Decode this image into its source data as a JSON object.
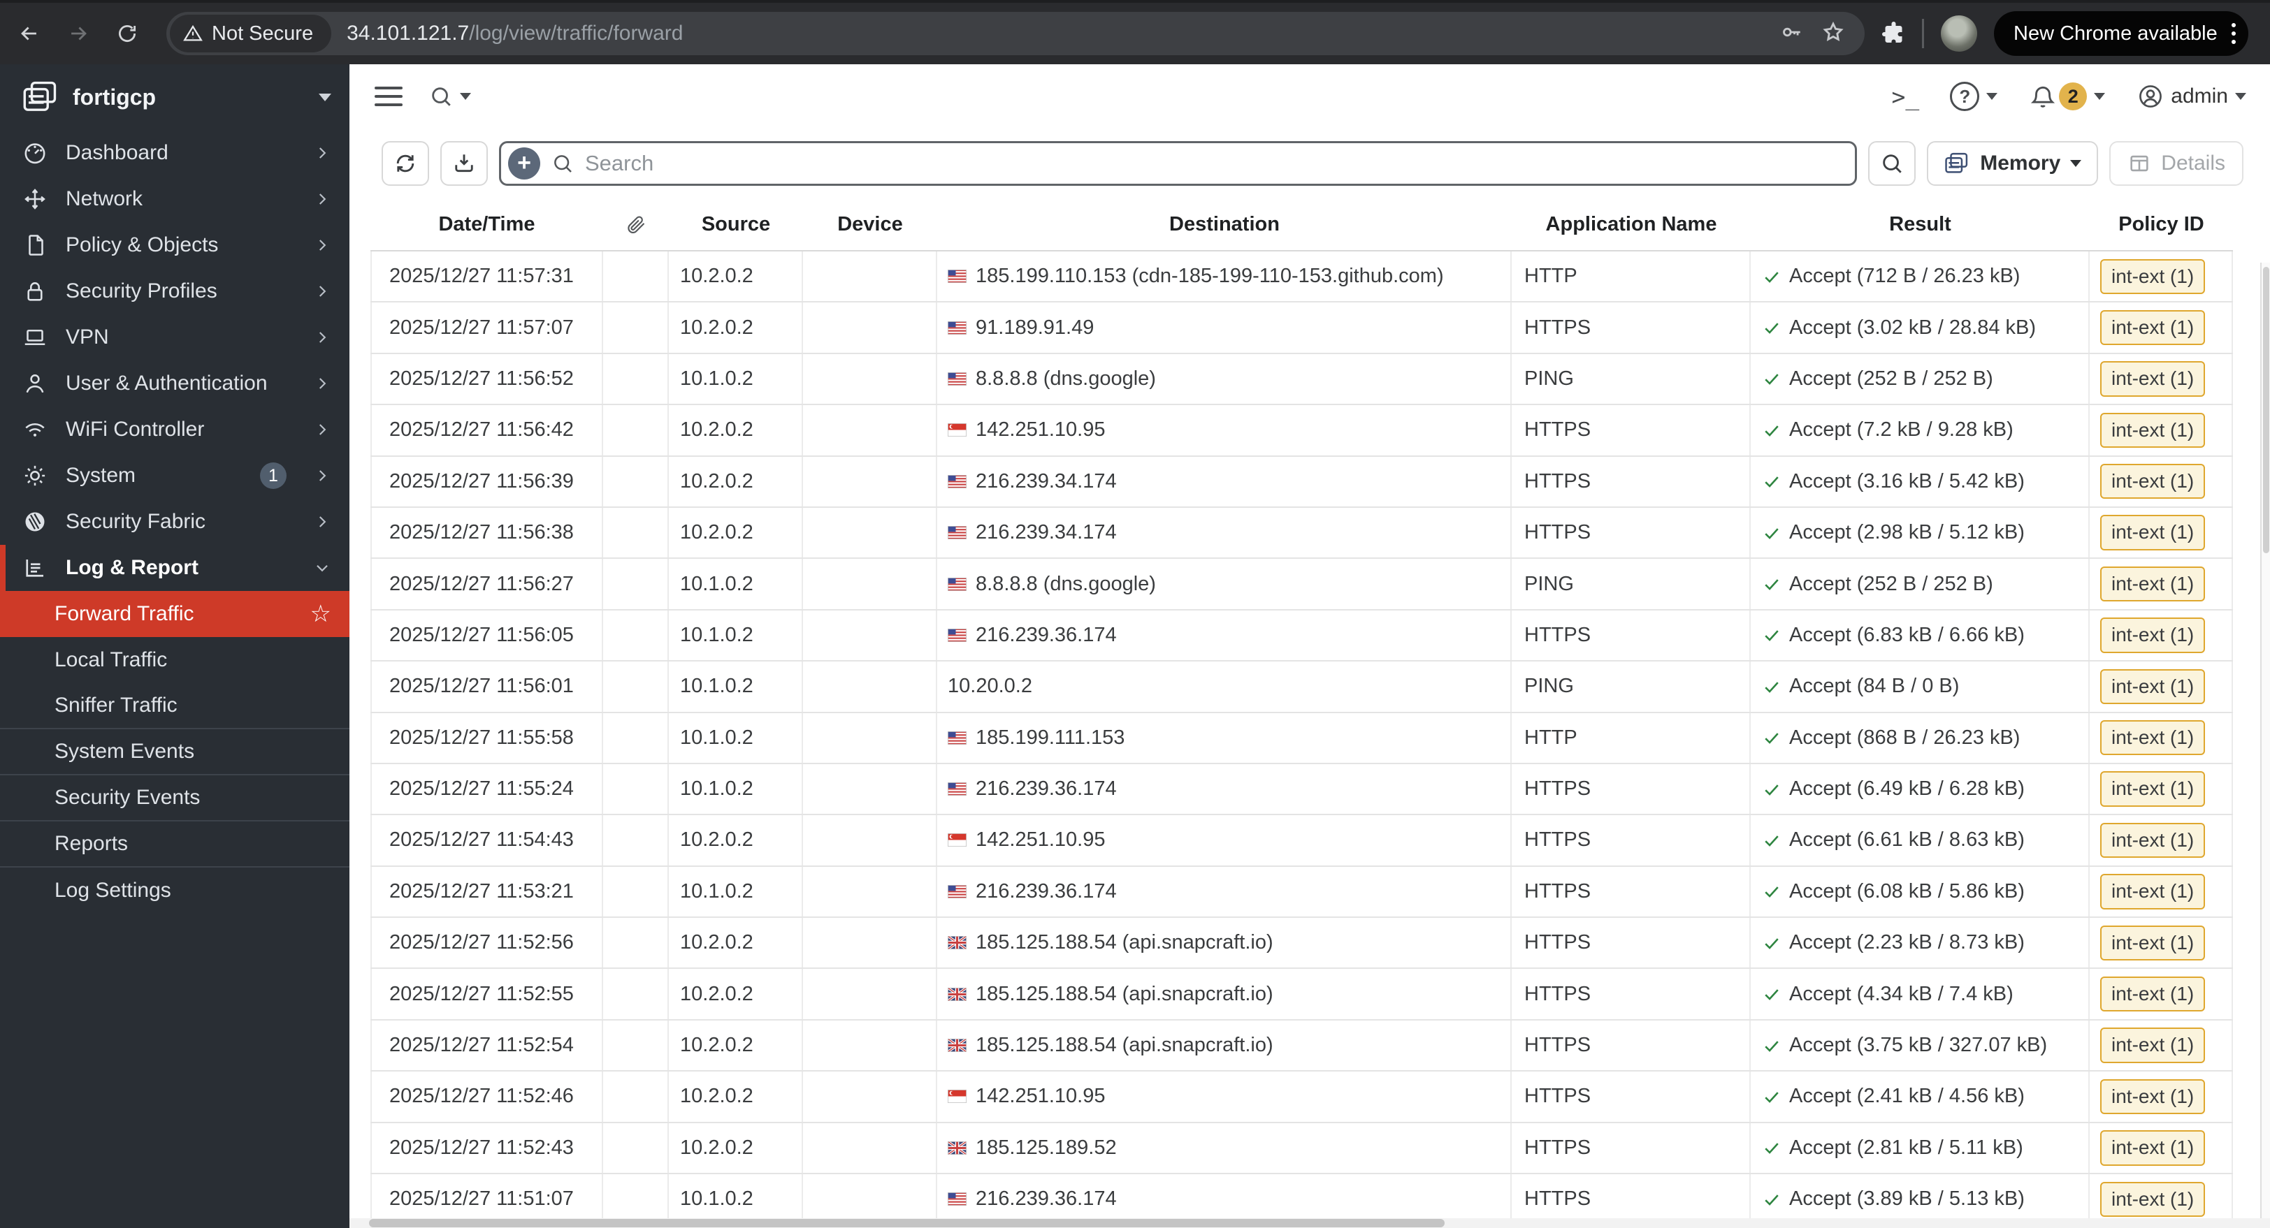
{
  "browser": {
    "security_chip": "Not Secure",
    "url_host": "34.101.121.7",
    "url_path": "/log/view/traffic/forward",
    "update_button": "New Chrome available"
  },
  "sidebar": {
    "brand": "fortigcp",
    "items": [
      {
        "label": "Dashboard",
        "icon": "dashboard"
      },
      {
        "label": "Network",
        "icon": "network"
      },
      {
        "label": "Policy & Objects",
        "icon": "policy"
      },
      {
        "label": "Security Profiles",
        "icon": "lock"
      },
      {
        "label": "VPN",
        "icon": "vpn"
      },
      {
        "label": "User & Authentication",
        "icon": "user"
      },
      {
        "label": "WiFi Controller",
        "icon": "wifi"
      },
      {
        "label": "System",
        "icon": "gear",
        "badge": "1"
      },
      {
        "label": "Security Fabric",
        "icon": "fabric"
      },
      {
        "label": "Log & Report",
        "icon": "log",
        "expanded": true
      }
    ],
    "submenu": [
      {
        "label": "Forward Traffic",
        "active": true,
        "starred": true
      },
      {
        "label": "Local Traffic"
      },
      {
        "label": "Sniffer Traffic",
        "divider_after": true
      },
      {
        "label": "System Events",
        "divider_after": true
      },
      {
        "label": "Security Events",
        "divider_after": true
      },
      {
        "label": "Reports",
        "divider_after": true
      },
      {
        "label": "Log Settings"
      }
    ]
  },
  "header": {
    "notification_count": "2",
    "user": "admin"
  },
  "toolbar": {
    "search_placeholder": "Search",
    "view_mode": "Memory",
    "details_label": "Details"
  },
  "table": {
    "columns": [
      "Date/Time",
      "",
      "Source",
      "Device",
      "Destination",
      "Application Name",
      "Result",
      "Policy ID"
    ],
    "rows": [
      {
        "datetime": "2025/12/27 11:57:31",
        "source": "10.2.0.2",
        "device": "",
        "flag": "us",
        "destination": "185.199.110.153 (cdn-185-199-110-153.github.com)",
        "app": "HTTP",
        "result": "Accept (712 B / 26.23 kB)",
        "policy": "int-ext (1)"
      },
      {
        "datetime": "2025/12/27 11:57:07",
        "source": "10.2.0.2",
        "device": "",
        "flag": "us",
        "destination": "91.189.91.49",
        "app": "HTTPS",
        "result": "Accept (3.02 kB / 28.84 kB)",
        "policy": "int-ext (1)"
      },
      {
        "datetime": "2025/12/27 11:56:52",
        "source": "10.1.0.2",
        "device": "",
        "flag": "us",
        "destination": "8.8.8.8 (dns.google)",
        "app": "PING",
        "result": "Accept (252 B / 252 B)",
        "policy": "int-ext (1)"
      },
      {
        "datetime": "2025/12/27 11:56:42",
        "source": "10.2.0.2",
        "device": "",
        "flag": "sg",
        "destination": "142.251.10.95",
        "app": "HTTPS",
        "result": "Accept (7.2 kB / 9.28 kB)",
        "policy": "int-ext (1)"
      },
      {
        "datetime": "2025/12/27 11:56:39",
        "source": "10.2.0.2",
        "device": "",
        "flag": "us",
        "destination": "216.239.34.174",
        "app": "HTTPS",
        "result": "Accept (3.16 kB / 5.42 kB)",
        "policy": "int-ext (1)"
      },
      {
        "datetime": "2025/12/27 11:56:38",
        "source": "10.2.0.2",
        "device": "",
        "flag": "us",
        "destination": "216.239.34.174",
        "app": "HTTPS",
        "result": "Accept (2.98 kB / 5.12 kB)",
        "policy": "int-ext (1)"
      },
      {
        "datetime": "2025/12/27 11:56:27",
        "source": "10.1.0.2",
        "device": "",
        "flag": "us",
        "destination": "8.8.8.8 (dns.google)",
        "app": "PING",
        "result": "Accept (252 B / 252 B)",
        "policy": "int-ext (1)"
      },
      {
        "datetime": "2025/12/27 11:56:05",
        "source": "10.1.0.2",
        "device": "",
        "flag": "us",
        "destination": "216.239.36.174",
        "app": "HTTPS",
        "result": "Accept (6.83 kB / 6.66 kB)",
        "policy": "int-ext (1)"
      },
      {
        "datetime": "2025/12/27 11:56:01",
        "source": "10.1.0.2",
        "device": "",
        "flag": null,
        "destination": "10.20.0.2",
        "app": "PING",
        "result": "Accept (84 B / 0 B)",
        "policy": "int-ext (1)"
      },
      {
        "datetime": "2025/12/27 11:55:58",
        "source": "10.1.0.2",
        "device": "",
        "flag": "us",
        "destination": "185.199.111.153",
        "app": "HTTP",
        "result": "Accept (868 B / 26.23 kB)",
        "policy": "int-ext (1)"
      },
      {
        "datetime": "2025/12/27 11:55:24",
        "source": "10.1.0.2",
        "device": "",
        "flag": "us",
        "destination": "216.239.36.174",
        "app": "HTTPS",
        "result": "Accept (6.49 kB / 6.28 kB)",
        "policy": "int-ext (1)"
      },
      {
        "datetime": "2025/12/27 11:54:43",
        "source": "10.2.0.2",
        "device": "",
        "flag": "sg",
        "destination": "142.251.10.95",
        "app": "HTTPS",
        "result": "Accept (6.61 kB / 8.63 kB)",
        "policy": "int-ext (1)"
      },
      {
        "datetime": "2025/12/27 11:53:21",
        "source": "10.1.0.2",
        "device": "",
        "flag": "us",
        "destination": "216.239.36.174",
        "app": "HTTPS",
        "result": "Accept (6.08 kB / 5.86 kB)",
        "policy": "int-ext (1)"
      },
      {
        "datetime": "2025/12/27 11:52:56",
        "source": "10.2.0.2",
        "device": "",
        "flag": "gb",
        "destination": "185.125.188.54 (api.snapcraft.io)",
        "app": "HTTPS",
        "result": "Accept (2.23 kB / 8.73 kB)",
        "policy": "int-ext (1)"
      },
      {
        "datetime": "2025/12/27 11:52:55",
        "source": "10.2.0.2",
        "device": "",
        "flag": "gb",
        "destination": "185.125.188.54 (api.snapcraft.io)",
        "app": "HTTPS",
        "result": "Accept (4.34 kB / 7.4 kB)",
        "policy": "int-ext (1)"
      },
      {
        "datetime": "2025/12/27 11:52:54",
        "source": "10.2.0.2",
        "device": "",
        "flag": "gb",
        "destination": "185.125.188.54 (api.snapcraft.io)",
        "app": "HTTPS",
        "result": "Accept (3.75 kB / 327.07 kB)",
        "policy": "int-ext (1)"
      },
      {
        "datetime": "2025/12/27 11:52:46",
        "source": "10.2.0.2",
        "device": "",
        "flag": "sg",
        "destination": "142.251.10.95",
        "app": "HTTPS",
        "result": "Accept (2.41 kB / 4.56 kB)",
        "policy": "int-ext (1)"
      },
      {
        "datetime": "2025/12/27 11:52:43",
        "source": "10.2.0.2",
        "device": "",
        "flag": "gb",
        "destination": "185.125.189.52",
        "app": "HTTPS",
        "result": "Accept (2.81 kB / 5.11 kB)",
        "policy": "int-ext (1)"
      },
      {
        "datetime": "2025/12/27 11:51:07",
        "source": "10.1.0.2",
        "device": "",
        "flag": "us",
        "destination": "216.239.36.174",
        "app": "HTTPS",
        "result": "Accept (3.89 kB / 5.13 kB)",
        "policy": "int-ext (1)"
      }
    ]
  },
  "colors": {
    "accent_red": "#ce3a28",
    "sidebar_bg": "#292e34",
    "badge_yellow_bg": "#fbf4dd",
    "badge_yellow_border": "#dfa72e",
    "notification_yellow": "#e2b34c",
    "result_green": "#2e8540"
  }
}
